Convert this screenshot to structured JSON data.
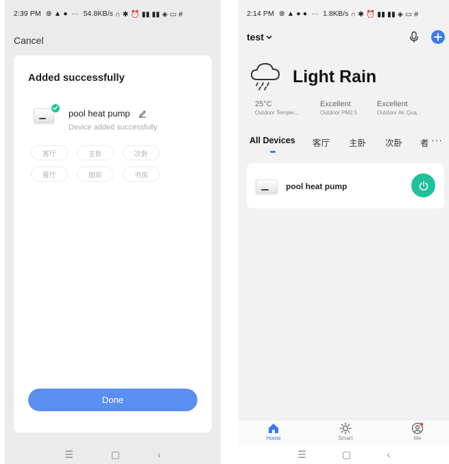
{
  "left": {
    "status": {
      "time": "2:39 PM",
      "net": "54.8KB/s"
    },
    "cancel_label": "Cancel",
    "card": {
      "title": "Added successfully",
      "device_name": "pool heat pump",
      "device_status": "Device added successfully",
      "rooms": [
        "客厅",
        "主卧",
        "次卧",
        "餐厅",
        "厨房",
        "书房"
      ],
      "done_label": "Done"
    }
  },
  "right": {
    "status": {
      "time": "2:14 PM",
      "net": "1.8KB/s"
    },
    "home_name": "test",
    "weather": {
      "condition": "Light Rain",
      "stats": [
        {
          "value": "25°C",
          "label": "Outdoor Temper..."
        },
        {
          "value": "Excellent",
          "label": "Outdoor PM2.5"
        },
        {
          "value": "Excellent",
          "label": "Outdoor Air Qua..."
        }
      ]
    },
    "room_tabs": [
      "All Devices",
      "客厅",
      "主卧",
      "次卧",
      "者"
    ],
    "device": {
      "name": "pool heat pump"
    },
    "tabbar": [
      {
        "label": "Home",
        "icon": "home-icon"
      },
      {
        "label": "Smart",
        "icon": "sun-icon"
      },
      {
        "label": "Me",
        "icon": "profile-icon"
      }
    ]
  },
  "colors": {
    "accent_green": "#1fc29a",
    "accent_blue": "#3a7bf5",
    "done_blue": "#5b8ef2"
  }
}
